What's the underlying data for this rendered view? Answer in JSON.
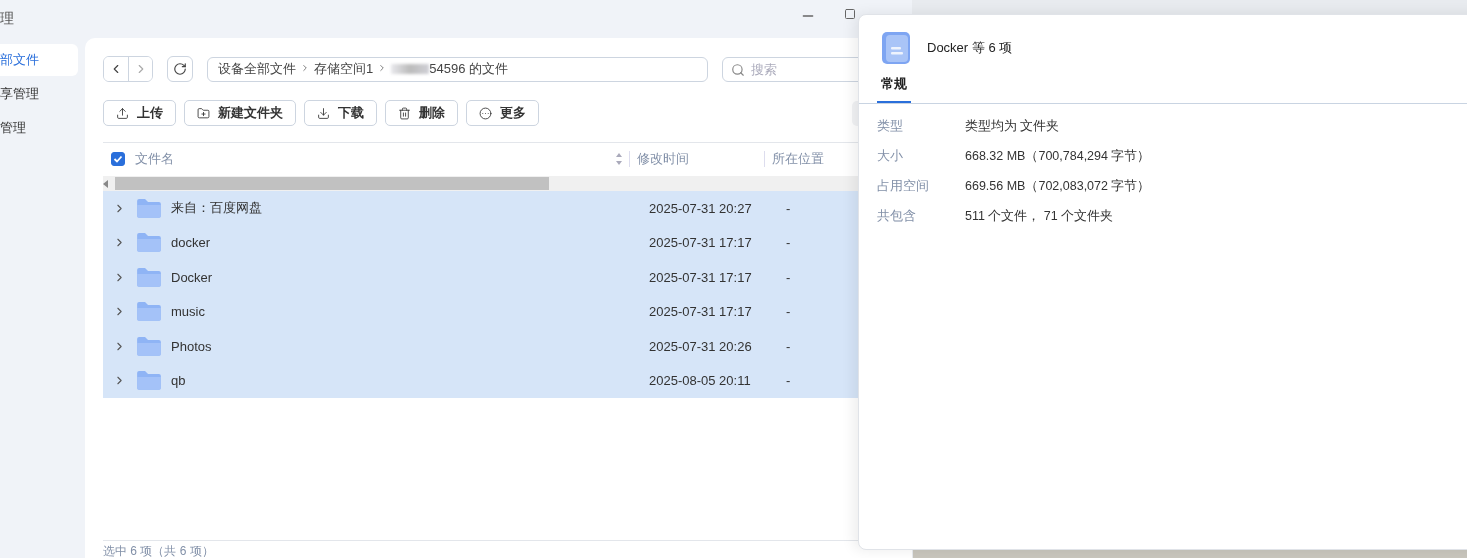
{
  "window": {
    "title": "理"
  },
  "sidebar": {
    "items": [
      {
        "label": "部文件",
        "selected": true
      },
      {
        "label": "享管理",
        "selected": false
      },
      {
        "label": "管理",
        "selected": false
      }
    ]
  },
  "breadcrumb": [
    {
      "label": "设备全部文件"
    },
    {
      "label": "存储空间1"
    },
    {
      "label": "54596 的文件",
      "masked": true
    }
  ],
  "search": {
    "placeholder": "搜索"
  },
  "toolbar": [
    {
      "kind": "upload",
      "label": "上传"
    },
    {
      "kind": "new-folder",
      "label": "新建文件夹"
    },
    {
      "kind": "download",
      "label": "下载"
    },
    {
      "kind": "delete",
      "label": "删除"
    },
    {
      "kind": "more",
      "label": "更多"
    }
  ],
  "table": {
    "select_all": {
      "checked": true
    },
    "columns": [
      "文件名",
      "修改时间",
      "所在位置"
    ],
    "rows": [
      {
        "name": "来自：百度网盘",
        "modified": "2025-07-31 20:27",
        "location": "-",
        "selected": true
      },
      {
        "name": "docker",
        "modified": "2025-07-31 17:17",
        "location": "-",
        "selected": true
      },
      {
        "name": "Docker",
        "modified": "2025-07-31 17:17",
        "location": "-",
        "selected": true
      },
      {
        "name": "music",
        "modified": "2025-07-31 17:17",
        "location": "-",
        "selected": true
      },
      {
        "name": "Photos",
        "modified": "2025-07-31 20:26",
        "location": "-",
        "selected": true
      },
      {
        "name": "qb",
        "modified": "2025-08-05 20:11",
        "location": "-",
        "selected": true
      }
    ]
  },
  "status_bar": "选中 6 项（共 6 项）",
  "properties": {
    "title": "Docker 等 6 项",
    "tabs": [
      {
        "label": "常规",
        "selected": true
      }
    ],
    "rows": [
      {
        "label": "类型",
        "value": "类型均为 文件夹"
      },
      {
        "label": "大小",
        "value": "668.32 MB（700,784,294 字节）"
      },
      {
        "label": "占用空间",
        "value": "669.56 MB（702,083,072 字节）"
      },
      {
        "label": "共包含",
        "value": "511 个文件， 71 个文件夹"
      }
    ]
  }
}
